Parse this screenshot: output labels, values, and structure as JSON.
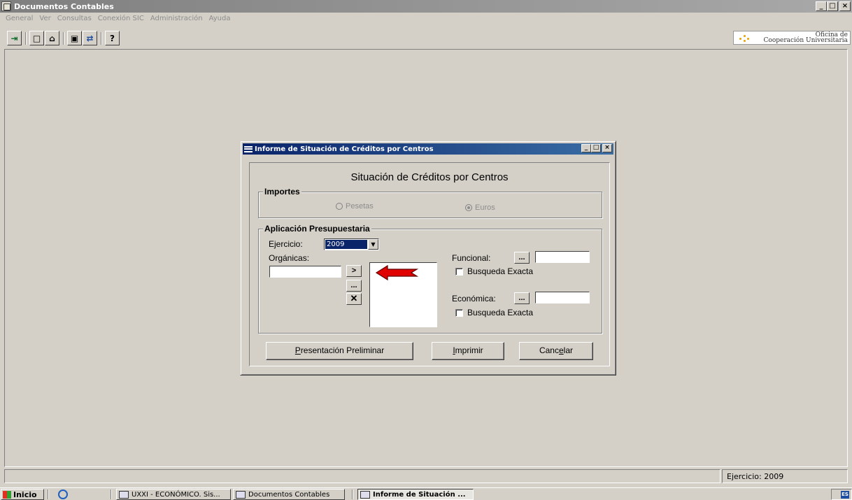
{
  "window": {
    "title": "Documentos Contables",
    "controls": [
      "_",
      "□",
      "×"
    ]
  },
  "menu": [
    "General",
    "Ver",
    "Consultas",
    "Conexión SIC",
    "Administración",
    "Ayuda"
  ],
  "toolbar": {
    "buttons": [
      {
        "name": "exit-icon",
        "glyph": "⇥"
      },
      {
        "name": "new-document-icon",
        "glyph": "□"
      },
      {
        "name": "open-folder-icon",
        "glyph": "⌂"
      },
      {
        "name": "save-icon",
        "glyph": "▣"
      },
      {
        "name": "connect-icon",
        "glyph": "⇄"
      },
      {
        "name": "help-icon",
        "glyph": "?"
      }
    ]
  },
  "logo": {
    "line1": "Oficina de",
    "line2": "Cooperación Universitaria"
  },
  "dialog": {
    "title": "Informe de Situación de Créditos por Centros",
    "heading": "Situación de Créditos por Centros",
    "importes": {
      "legend": "Importes",
      "options": [
        {
          "label": "Pesetas",
          "selected": false,
          "enabled": false
        },
        {
          "label": "Euros",
          "selected": true,
          "enabled": false
        }
      ]
    },
    "aplicacion": {
      "legend": "Aplicación Presupuestaria",
      "ejercicio_label": "Ejercicio:",
      "ejercicio_value": "2009",
      "organicas_label": "Orgánicas:",
      "organicas_value": "",
      "add_button": ">",
      "browse_button": "...",
      "remove_button": "✕",
      "funcional_label": "Funcional:",
      "funcional_value": "",
      "funcional_browse": "...",
      "funcional_exacta": {
        "label": "Busqueda Exacta",
        "checked": false
      },
      "economica_label": "Económica:",
      "economica_value": "",
      "economica_browse": "...",
      "economica_exacta": {
        "label": "Busqueda Exacta",
        "checked": false
      }
    },
    "buttons": {
      "preview": {
        "prefix": "",
        "underline": "P",
        "suffix": "resentación Preliminar"
      },
      "print": {
        "prefix": "",
        "underline": "I",
        "suffix": "mprimir"
      },
      "cancel": {
        "prefix": "Canc",
        "underline": "e",
        "suffix": "lar"
      }
    }
  },
  "status": {
    "ejercicio": "Ejercicio: 2009"
  },
  "taskbar": {
    "start": "Inicio",
    "tasks": [
      {
        "label": "UXXI - ECONÓMICO. Sis...",
        "active": false
      },
      {
        "label": "Documentos Contables",
        "active": false
      },
      {
        "label": "Informe de Situación ...",
        "active": true
      }
    ],
    "tray_lang": "ES"
  },
  "colors": {
    "accent": "#0a246a",
    "arrow": "#e00000",
    "face": "#d4d0c8"
  }
}
